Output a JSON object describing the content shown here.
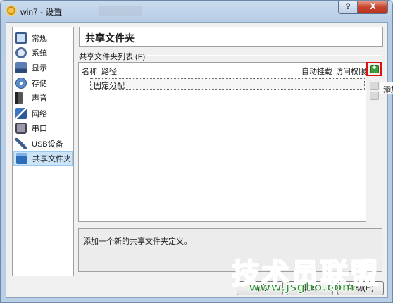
{
  "window": {
    "title": "win7 - 设置",
    "help_label": "?",
    "close_label": "X"
  },
  "sidebar": {
    "items": [
      {
        "label": "常规"
      },
      {
        "label": "系统"
      },
      {
        "label": "显示"
      },
      {
        "label": "存储"
      },
      {
        "label": "声音"
      },
      {
        "label": "网络"
      },
      {
        "label": "串口"
      },
      {
        "label": "USB设备"
      },
      {
        "label": "共享文件夹"
      }
    ],
    "selected": "共享文件夹"
  },
  "panel": {
    "title": "共享文件夹",
    "group_label": "共享文件夹列表 (F)",
    "columns": {
      "name": "名称",
      "path": "路径",
      "auto_mount": "自动挂载",
      "access": "访问权限"
    },
    "rows": [
      {
        "name": "固定分配"
      }
    ],
    "tooltip": "添加",
    "description": "添加一个新的共享文件夹定义。"
  },
  "buttons": {
    "ok": "确定",
    "cancel": "取消",
    "help": "帮助(H)"
  },
  "watermark": {
    "main": "技术员联盟",
    "url": "www.jsgho.com"
  }
}
